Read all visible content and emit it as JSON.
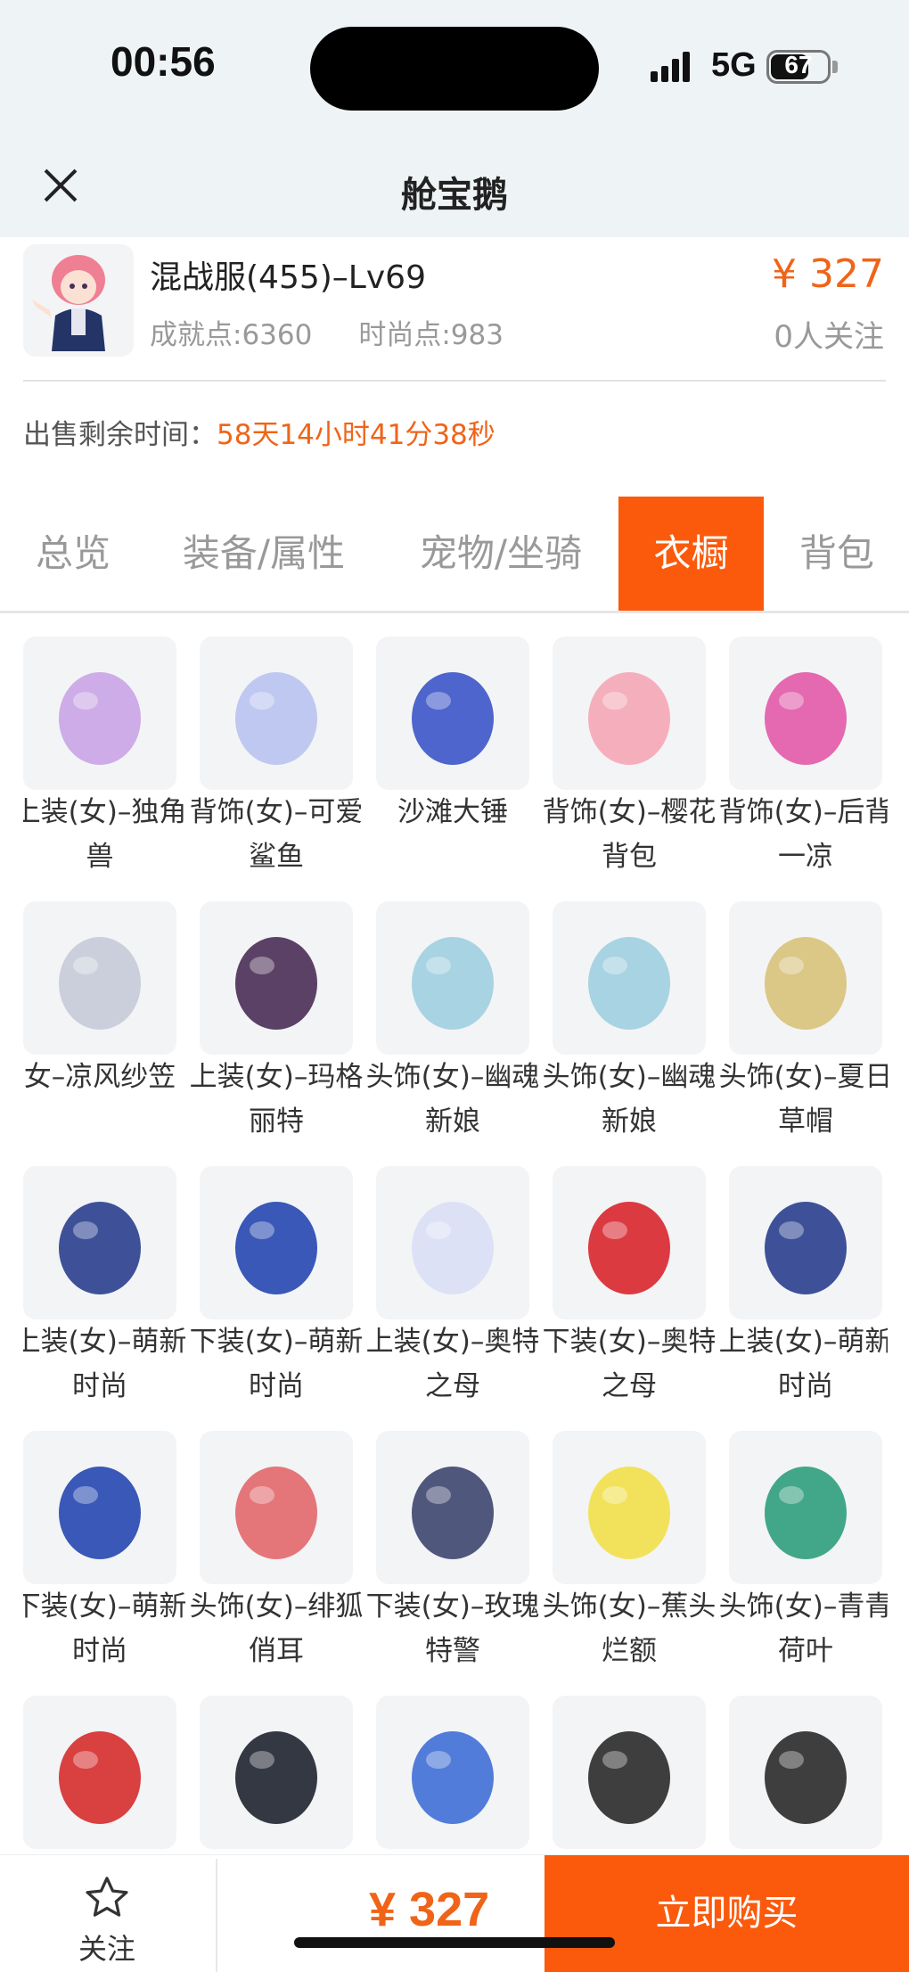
{
  "status": {
    "time": "00:56",
    "network": "5G",
    "battery": "67",
    "battery_level": 0.67
  },
  "nav": {
    "title": "舱宝鹅"
  },
  "product": {
    "name": "混战服(455)–Lv69",
    "achievement": "成就点:6360",
    "fashion": "时尚点:983",
    "price": "¥ 327",
    "followers": "0人关注",
    "sale_label": "出售剩余时间：",
    "sale_time": "58天14小时41分38秒"
  },
  "tabs": [
    "总览",
    "装备/属性",
    "宠物/坐骑",
    "衣橱",
    "背包"
  ],
  "active_tab": 3,
  "items": [
    {
      "name": "上装(女)–独角兽",
      "color": "#c9a4e6"
    },
    {
      "name": "背饰(女)–可爱鲨鱼",
      "color": "#b9c3ef"
    },
    {
      "name": "沙滩大锤",
      "color": "#3b55c8"
    },
    {
      "name": "背饰(女)–樱花背包",
      "color": "#f5a7b6"
    },
    {
      "name": "背饰(女)–后背一凉",
      "color": "#e25aa8"
    },
    {
      "name": "女–凉风纱笠",
      "color": "#c5cbd8"
    },
    {
      "name": "上装(女)–玛格丽特",
      "color": "#4a2e55"
    },
    {
      "name": "头饰(女)–幽魂新娘",
      "color": "#9fcfe0"
    },
    {
      "name": "头饰(女)–幽魂新娘",
      "color": "#9fcfe0"
    },
    {
      "name": "头饰(女)–夏日草帽",
      "color": "#d8c27a"
    },
    {
      "name": "上装(女)–萌新时尚",
      "color": "#2a3f8e"
    },
    {
      "name": "下装(女)–萌新时尚",
      "color": "#2547b0"
    },
    {
      "name": "上装(女)–奥特之母",
      "color": "#d9dff5"
    },
    {
      "name": "下装(女)–奥特之母",
      "color": "#d8262e"
    },
    {
      "name": "上装(女)–萌新时尚",
      "color": "#2a3f8e"
    },
    {
      "name": "下装(女)–萌新时尚",
      "color": "#2547b0"
    },
    {
      "name": "头饰(女)–绯狐俏耳",
      "color": "#e2686b"
    },
    {
      "name": "下装(女)–玫瑰特警",
      "color": "#3e4670"
    },
    {
      "name": "头饰(女)–蕉头烂额",
      "color": "#f2e04a"
    },
    {
      "name": "头饰(女)–青青荷叶",
      "color": "#2f9e7c"
    },
    {
      "name": "",
      "color": "#d62c2c"
    },
    {
      "name": "",
      "color": "#1f2330"
    },
    {
      "name": "",
      "color": "#3f6fd6"
    },
    {
      "name": "",
      "color": "#2a2a2a"
    },
    {
      "name": "",
      "color": "#2a2a2a"
    }
  ],
  "bottom": {
    "follow_label": "关注",
    "price": "¥ 327",
    "buy_label": "立即购买"
  },
  "colors": {
    "accent": "#fb5a0c",
    "price": "#f06418"
  }
}
